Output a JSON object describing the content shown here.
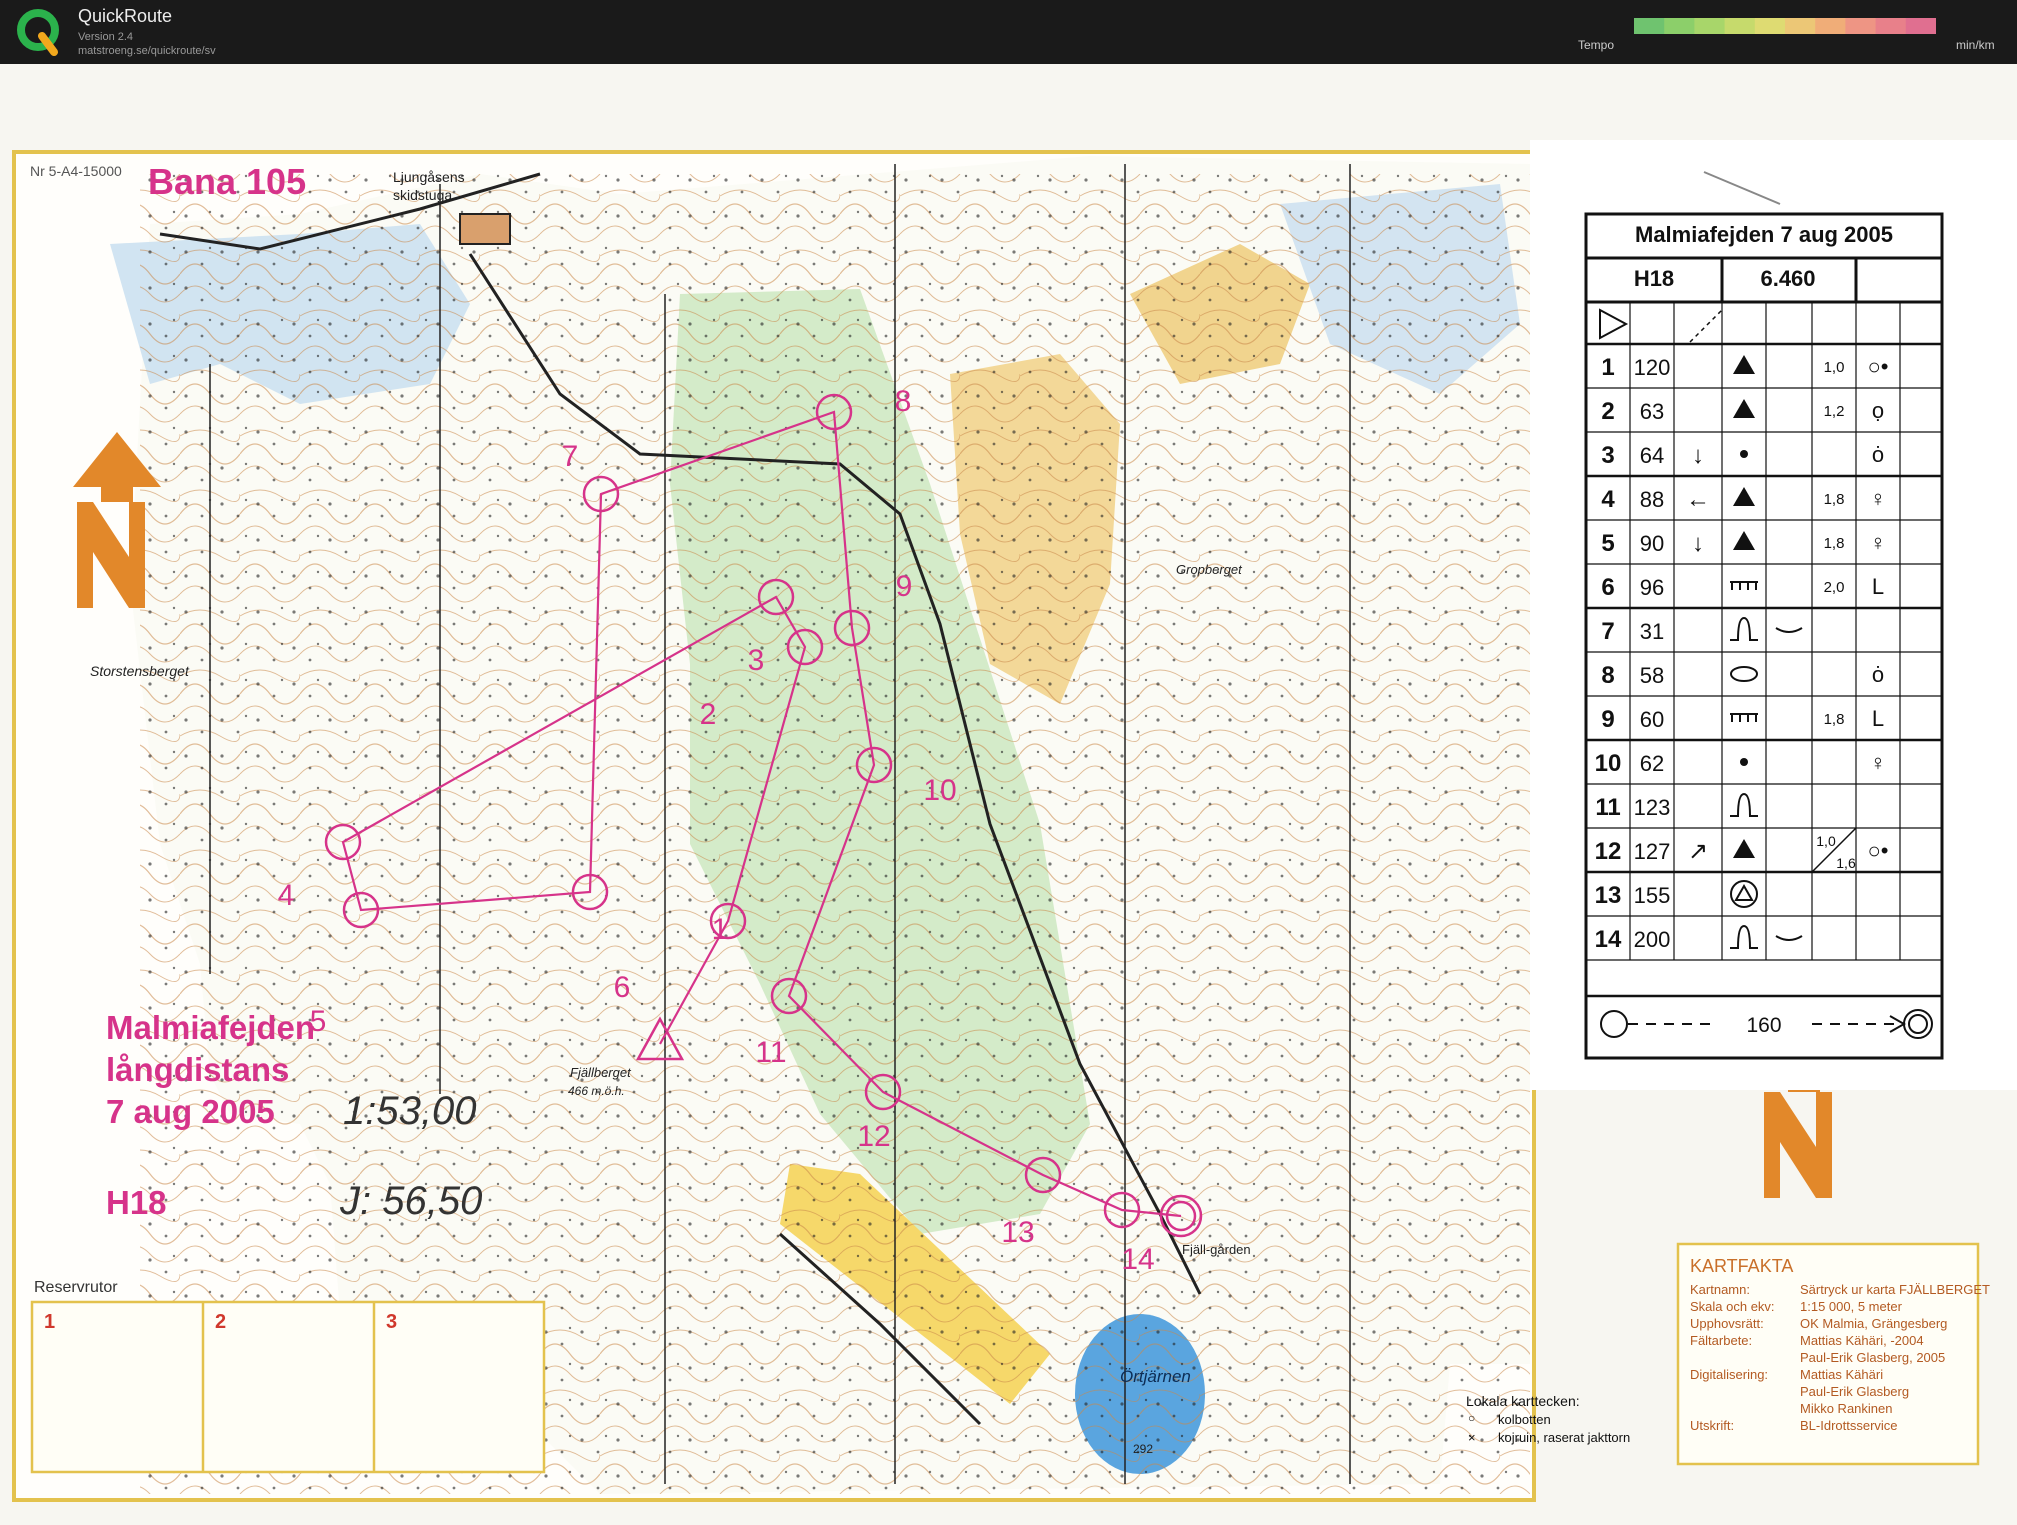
{
  "app": {
    "title": "QuickRoute",
    "version": "Version 2.4",
    "url": "matstroeng.se/quickroute/sv",
    "tempo_label": "Tempo",
    "tempo_unit": "min/km",
    "tempo_colors": [
      "#6fc36f",
      "#8ccf6a",
      "#a8d66a",
      "#c6da6c",
      "#dedb72",
      "#ecc776",
      "#f0ad78",
      "#ee9584",
      "#e8808a",
      "#e06f90"
    ]
  },
  "map": {
    "map_code": "Nr 5-A4-15000",
    "course_title": "Bana 105",
    "place_names": [
      "Ljungåsens skidstuga",
      "Storstensberget",
      "Gropberget",
      "Fjällberget",
      "466 m.ö.h.",
      "Fjäll-gården",
      "Örtjärnen",
      "292"
    ],
    "event_title_lines": [
      "Malmiafejden",
      "långdistans",
      "7 aug 2005"
    ],
    "class_label": "H18",
    "handwritten_times": [
      "1:53,00",
      "J: 56,50"
    ],
    "reserve_label": "Reservrutor",
    "reserve_boxes": [
      "1",
      "2",
      "3"
    ],
    "legend_title": "Lokala karttecken:",
    "legend_items": [
      "kolbotten",
      "kojruin, raserat jakttorn"
    ],
    "control_numbers": [
      "1",
      "2",
      "3",
      "4",
      "5",
      "6",
      "7",
      "8",
      "9",
      "10",
      "11",
      "12",
      "13",
      "14"
    ]
  },
  "description_sheet": {
    "title": "Malmiafejden 7 aug 2005",
    "class": "H18",
    "distance": "6.460",
    "rows": [
      {
        "num": "1",
        "code": "120",
        "extra": "1,0"
      },
      {
        "num": "2",
        "code": "63",
        "extra": "1,2"
      },
      {
        "num": "3",
        "code": "64",
        "extra": ""
      },
      {
        "num": "4",
        "code": "88",
        "extra": "1,8"
      },
      {
        "num": "5",
        "code": "90",
        "extra": "1,8"
      },
      {
        "num": "6",
        "code": "96",
        "extra": "2,0"
      },
      {
        "num": "7",
        "code": "31",
        "extra": ""
      },
      {
        "num": "8",
        "code": "58",
        "extra": ""
      },
      {
        "num": "9",
        "code": "60",
        "extra": "1,8"
      },
      {
        "num": "10",
        "code": "62",
        "extra": ""
      },
      {
        "num": "11",
        "code": "123",
        "extra": ""
      },
      {
        "num": "12",
        "code": "127",
        "extra": "1,0 / 1,6"
      },
      {
        "num": "13",
        "code": "155",
        "extra": ""
      },
      {
        "num": "14",
        "code": "200",
        "extra": ""
      }
    ],
    "finish_distance": "160"
  },
  "kartfakta": {
    "title": "KARTFAKTA",
    "rows": [
      {
        "label": "Kartnamn:",
        "value": "Särtryck ur karta FJÄLLBERGET"
      },
      {
        "label": "Skala och ekv:",
        "value": "1:15 000, 5 meter"
      },
      {
        "label": "Upphovsrätt:",
        "value": "OK Malmia, Grängesberg"
      },
      {
        "label": "Fältarbete:",
        "value": "Mattias Kähäri, -2004"
      },
      {
        "label": "",
        "value": "Paul-Erik Glasberg, 2005"
      },
      {
        "label": "Digitalisering:",
        "value": "Mattias Kähäri"
      },
      {
        "label": "",
        "value": "Paul-Erik Glasberg"
      },
      {
        "label": "",
        "value": "Mikko Rankinen"
      },
      {
        "label": "Utskrift:",
        "value": "BL-Idrottsservice"
      }
    ]
  }
}
